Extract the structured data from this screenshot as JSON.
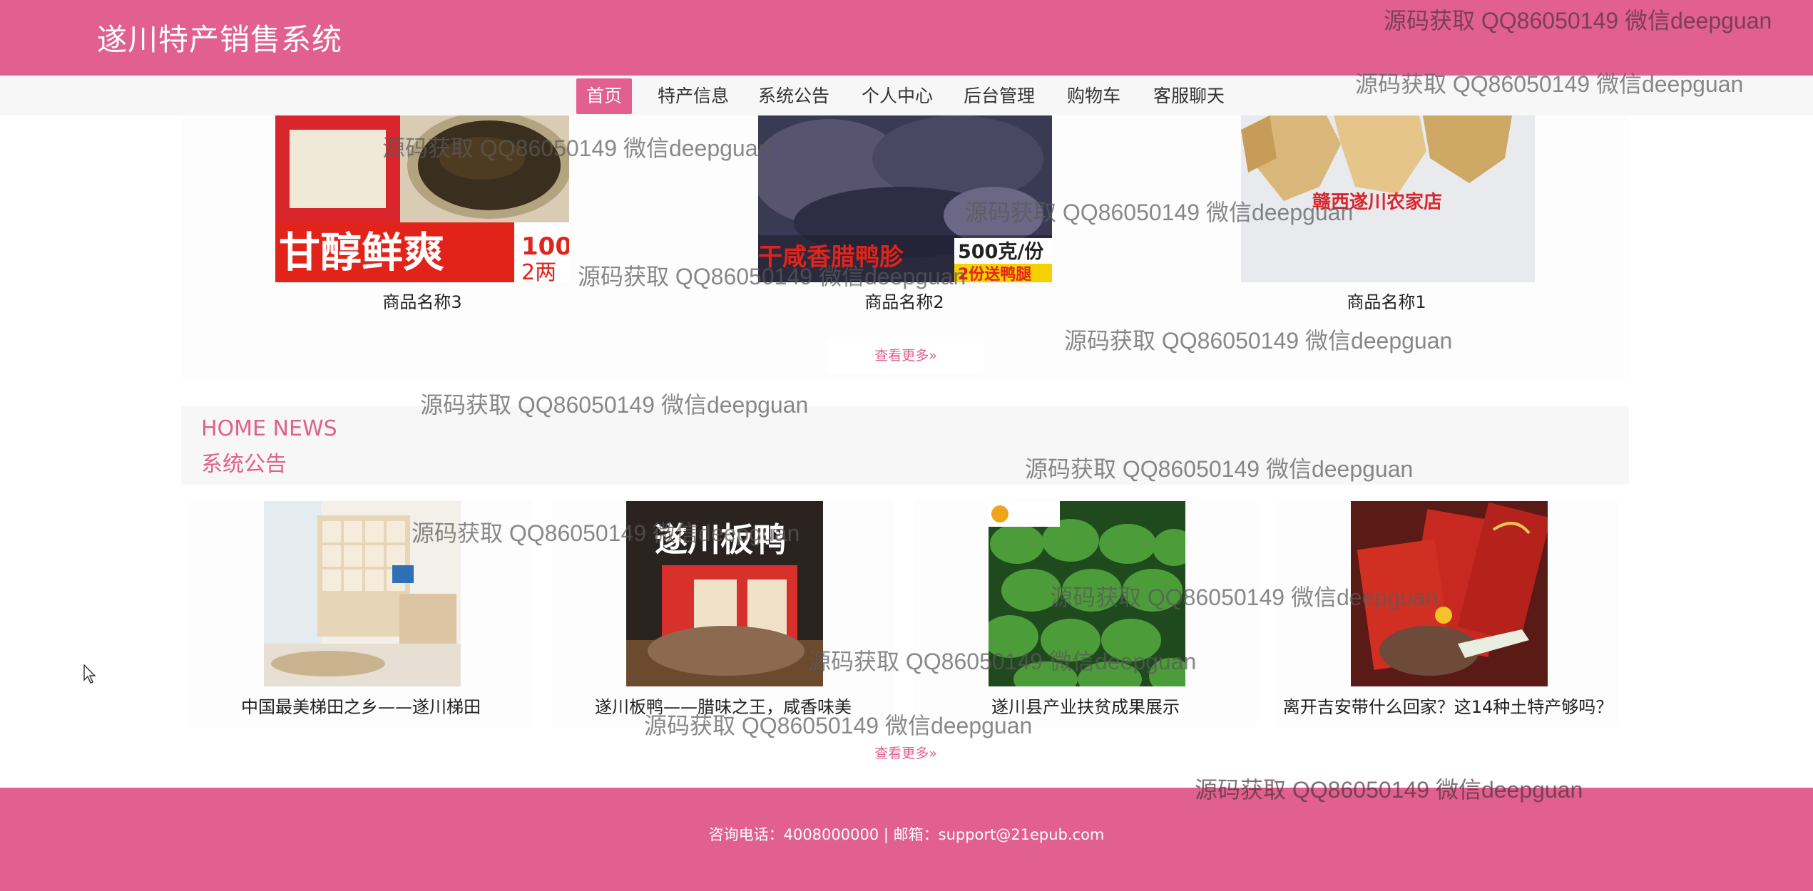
{
  "header": {
    "title": "遂川特产销售系统"
  },
  "nav": {
    "items": [
      {
        "label": "首页",
        "active": true
      },
      {
        "label": "特产信息",
        "active": false
      },
      {
        "label": "系统公告",
        "active": false
      },
      {
        "label": "个人中心",
        "active": false
      },
      {
        "label": "后台管理",
        "active": false
      },
      {
        "label": "购物车",
        "active": false
      },
      {
        "label": "客服聊天",
        "active": false
      }
    ]
  },
  "products": {
    "items": [
      {
        "name": "商品名称3",
        "image_text": [
          "甘醇鲜爽",
          "100",
          "2两"
        ]
      },
      {
        "name": "商品名称2",
        "image_text": [
          "干咸香腊鸭胗",
          "500克/份",
          "2份送鸭腿"
        ]
      },
      {
        "name": "商品名称1",
        "image_text": [
          "赣西遂川农家店"
        ]
      }
    ],
    "more_label": "查看更多»"
  },
  "news": {
    "heading_en": "HOME NEWS",
    "heading_zh": "系统公告",
    "items": [
      {
        "title": "中国最美梯田之乡——遂川梯田",
        "image_text": ""
      },
      {
        "title": "遂川板鸭——腊味之王，咸香味美",
        "image_text": "遂川板鸭"
      },
      {
        "title": "遂川县产业扶贫成果展示",
        "image_text": ""
      },
      {
        "title": "离开吉安带什么回家？这14种土特产够吗？",
        "image_text": ""
      }
    ],
    "more_label": "查看更多»"
  },
  "footer": {
    "contact": "咨询电话：4008000000 | 邮箱：support@21epub.com"
  },
  "watermark": {
    "text": "源码获取 QQ86050149 微信deepguan"
  },
  "colors": {
    "brand": "#e1608d",
    "nav_bg": "#f7f7f7"
  }
}
